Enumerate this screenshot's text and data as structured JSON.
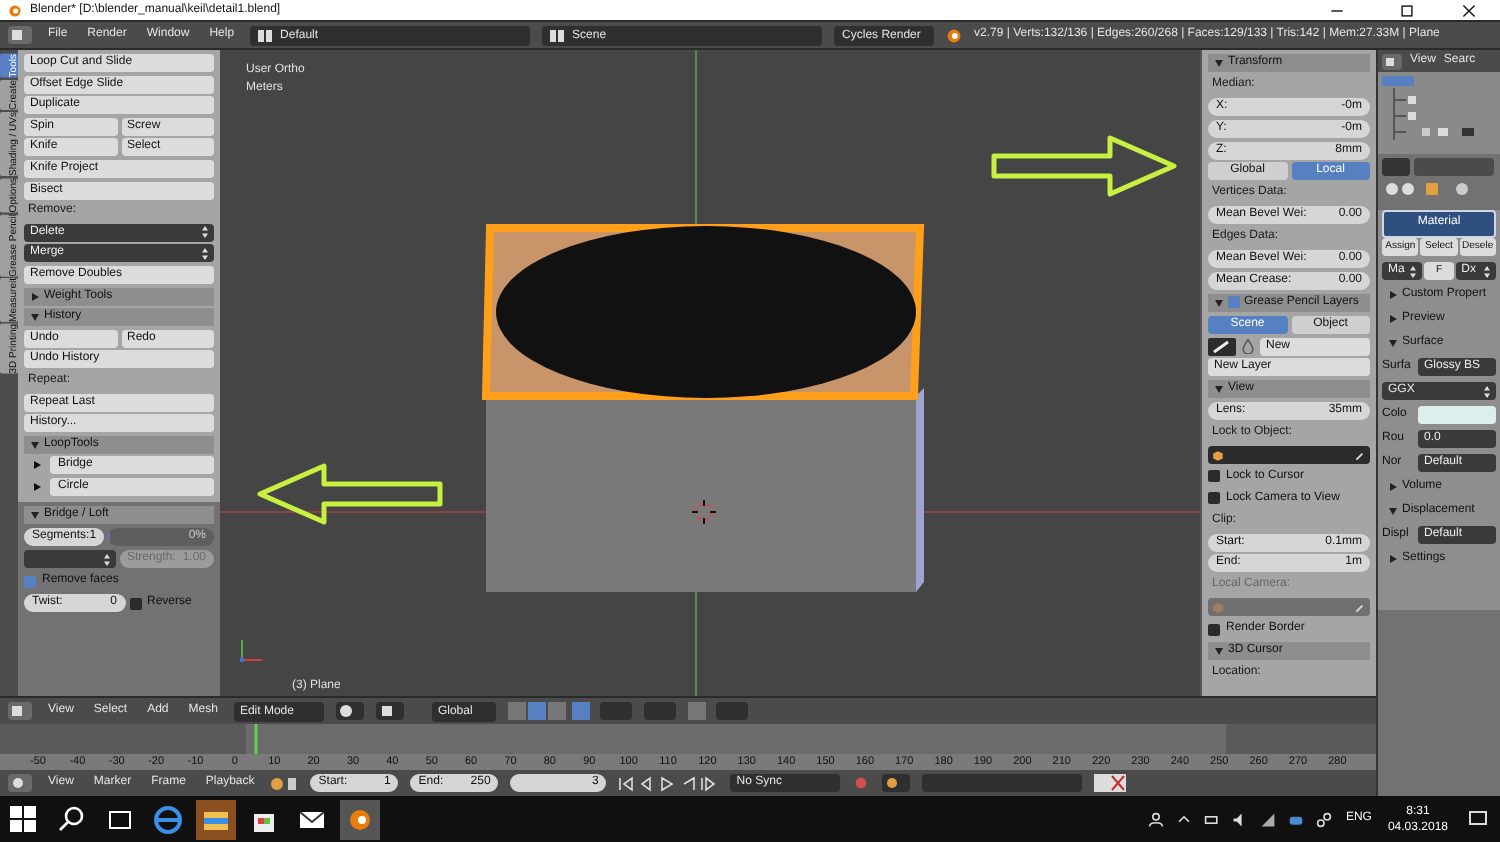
{
  "window": {
    "title": "Blender* [D:\\blender_manual\\keil\\detail1.blend]"
  },
  "info_header": {
    "menus": [
      "File",
      "Render",
      "Window",
      "Help"
    ],
    "layout": "Default",
    "scene": "Scene",
    "engine": "Cycles Render",
    "stats": "v2.79 | Verts:132/136 | Edges:260/268 | Faces:129/133 | Tris:142 | Mem:27.33M | Plane"
  },
  "tool_tabs": [
    {
      "label": "Tools",
      "selected": true
    },
    {
      "label": "Create",
      "selected": false
    },
    {
      "label": "Shading / UVs",
      "selected": false
    },
    {
      "label": "Options",
      "selected": false
    },
    {
      "label": "Grease Pencil",
      "selected": false
    },
    {
      "label": "Measureit",
      "selected": false
    },
    {
      "label": "3D Printing",
      "selected": false
    }
  ],
  "tool_panel": {
    "rows": [
      {
        "items": [
          {
            "kind": "button",
            "label": "Loop Cut and Slide"
          }
        ]
      },
      {
        "items": [
          {
            "kind": "button",
            "label": "Offset Edge Slide"
          }
        ]
      },
      {
        "items": [
          {
            "kind": "button",
            "label": "Duplicate"
          }
        ]
      },
      {
        "items": [
          {
            "kind": "button",
            "label": "Spin"
          },
          {
            "kind": "button",
            "label": "Screw"
          }
        ]
      },
      {
        "items": [
          {
            "kind": "button",
            "label": "Knife"
          },
          {
            "kind": "button",
            "label": "Select"
          }
        ]
      },
      {
        "items": [
          {
            "kind": "button",
            "label": "Knife Project"
          }
        ]
      },
      {
        "items": [
          {
            "kind": "button",
            "label": "Bisect"
          }
        ]
      },
      {
        "items": [
          {
            "kind": "label",
            "label": "Remove:",
            "disabled": false
          }
        ]
      },
      {
        "items": [
          {
            "kind": "dropdown",
            "label": "Delete"
          }
        ]
      },
      {
        "items": [
          {
            "kind": "dropdown",
            "label": "Merge"
          }
        ]
      },
      {
        "items": [
          {
            "kind": "button",
            "label": "Remove Doubles"
          }
        ]
      },
      {
        "items": [
          {
            "kind": "header",
            "label": "Weight Tools",
            "expanded": false
          }
        ]
      },
      {
        "items": [
          {
            "kind": "header",
            "label": "History",
            "expanded": true
          }
        ]
      },
      {
        "items": [
          {
            "kind": "button",
            "label": "Undo"
          },
          {
            "kind": "button",
            "label": "Redo"
          }
        ]
      },
      {
        "items": [
          {
            "kind": "button",
            "label": "Undo History"
          }
        ]
      },
      {
        "items": [
          {
            "kind": "label",
            "label": "Repeat:",
            "disabled": false
          }
        ]
      },
      {
        "items": [
          {
            "kind": "button",
            "label": "Repeat Last"
          }
        ]
      },
      {
        "items": [
          {
            "kind": "button",
            "label": "History..."
          }
        ]
      },
      {
        "items": [
          {
            "kind": "header",
            "label": "LoopTools",
            "expanded": true
          }
        ]
      },
      {
        "items": [
          {
            "kind": "tree",
            "label": "Bridge"
          }
        ]
      },
      {
        "items": [
          {
            "kind": "tree",
            "label": "Circle"
          }
        ]
      }
    ]
  },
  "redo_panel": {
    "rows": [
      {
        "items": [
          {
            "kind": "header",
            "label": "Bridge / Loft",
            "expanded": true
          }
        ]
      },
      {
        "items": [
          {
            "kind": "field",
            "label": "Segments:",
            "value": "1",
            "disabled": false
          },
          {
            "kind": "slider",
            "value": "0%",
            "level": 0
          }
        ]
      },
      {
        "items": [
          {
            "kind": "dropdown"
          },
          {
            "kind": "field",
            "label": "Strength:",
            "value": "1.00",
            "disabled": true
          }
        ]
      },
      {
        "items": [
          {
            "kind": "check",
            "label": "Remove faces",
            "checked": true
          }
        ]
      },
      {
        "items": [
          {
            "kind": "field",
            "label": "Twist:",
            "value": "0",
            "disabled": false
          },
          {
            "kind": "check",
            "label": "Reverse",
            "checked": false
          }
        ]
      }
    ]
  },
  "viewport": {
    "view_name": "User Ortho",
    "units": "Meters",
    "object_info": "(3) Plane"
  },
  "n_panel": {
    "rows": [
      {
        "items": [
          {
            "kind": "header",
            "label": "Transform",
            "expanded": true
          }
        ]
      },
      {
        "items": [
          {
            "kind": "label",
            "label": "Median:",
            "disabled": false
          }
        ]
      },
      {
        "items": [
          {
            "kind": "field",
            "label": "X:",
            "value": "-0m",
            "disabled": false
          }
        ]
      },
      {
        "items": [
          {
            "kind": "field",
            "label": "Y:",
            "value": "-0m",
            "disabled": false
          }
        ]
      },
      {
        "items": [
          {
            "kind": "field",
            "label": "Z:",
            "value": "8mm",
            "disabled": false
          }
        ]
      },
      {
        "items": [
          {
            "kind": "tab",
            "label": "Global",
            "selected": false
          },
          {
            "kind": "tab",
            "label": "Local",
            "selected": true
          }
        ]
      },
      {
        "items": [
          {
            "kind": "label",
            "label": "Vertices Data:",
            "disabled": false
          }
        ]
      },
      {
        "items": [
          {
            "kind": "field",
            "label": "Mean Bevel Wei:",
            "value": "0.00",
            "disabled": false
          }
        ]
      },
      {
        "items": [
          {
            "kind": "label",
            "label": "Edges Data:",
            "disabled": false
          }
        ]
      },
      {
        "items": [
          {
            "kind": "field",
            "label": "Mean Bevel Wei:",
            "value": "0.00",
            "disabled": false
          }
        ]
      },
      {
        "items": [
          {
            "kind": "field",
            "label": "Mean Crease:",
            "value": "0.00",
            "disabled": false
          }
        ]
      },
      {
        "items": [
          {
            "kind": "header",
            "label": "Grease Pencil Layers",
            "expanded": true,
            "checked": true
          }
        ]
      },
      {
        "items": [
          {
            "kind": "tab",
            "label": "Scene",
            "selected": true
          },
          {
            "kind": "tab",
            "label": "Object",
            "selected": false
          }
        ]
      },
      {
        "items": [
          {
            "kind": "pencil_button"
          },
          {
            "kind": "drop_icon"
          },
          {
            "kind": "button",
            "label": "New"
          }
        ]
      },
      {
        "items": [
          {
            "kind": "button",
            "label": "New Layer"
          }
        ]
      },
      {
        "items": [
          {
            "kind": "header",
            "label": "View",
            "expanded": true
          }
        ]
      },
      {
        "items": [
          {
            "kind": "field",
            "label": "Lens:",
            "value": "35mm",
            "disabled": false
          }
        ]
      },
      {
        "items": [
          {
            "kind": "label",
            "label": "Lock to Object:",
            "disabled": false
          }
        ]
      },
      {
        "items": [
          {
            "kind": "object_field",
            "disabled": false
          }
        ]
      },
      {
        "items": [
          {
            "kind": "check",
            "label": "Lock to Cursor",
            "checked": false
          }
        ]
      },
      {
        "items": [
          {
            "kind": "check",
            "label": "Lock Camera to View",
            "checked": false
          }
        ]
      },
      {
        "items": [
          {
            "kind": "label",
            "label": "Clip:",
            "disabled": false
          }
        ]
      },
      {
        "items": [
          {
            "kind": "field",
            "label": "Start:",
            "value": "0.1mm",
            "disabled": false
          }
        ]
      },
      {
        "items": [
          {
            "kind": "field",
            "label": "End:",
            "value": "1m",
            "disabled": false
          }
        ]
      },
      {
        "items": [
          {
            "kind": "label",
            "label": "Local Camera:",
            "disabled": true
          }
        ]
      },
      {
        "items": [
          {
            "kind": "object_field",
            "disabled": true
          }
        ]
      },
      {
        "items": [
          {
            "kind": "check",
            "label": "Render Border",
            "checked": false
          }
        ]
      },
      {
        "items": [
          {
            "kind": "header",
            "label": "3D Cursor",
            "expanded": true
          }
        ]
      },
      {
        "items": [
          {
            "kind": "label",
            "label": "Location:",
            "disabled": false
          }
        ]
      }
    ]
  },
  "outliner": {
    "menus": [
      "View",
      "Searc"
    ]
  },
  "properties": {
    "rows": [
      {
        "items": [
          {
            "kind": "material_slot",
            "label": "Material"
          }
        ]
      },
      {
        "items": [
          {
            "kind": "button",
            "label": "Assign"
          },
          {
            "kind": "button",
            "label": "Select"
          },
          {
            "kind": "button",
            "label": "Desele"
          }
        ]
      },
      {
        "items": [
          {
            "kind": "dropdown",
            "label": "Ma"
          },
          {
            "kind": "button",
            "label": "F"
          },
          {
            "kind": "dropdown",
            "label": "Dx"
          }
        ]
      },
      {
        "items": [
          {
            "kind": "header",
            "label": "Custom Propert",
            "expanded": false
          }
        ]
      },
      {
        "items": [
          {
            "kind": "header",
            "label": "Preview",
            "expanded": false
          }
        ]
      },
      {
        "items": [
          {
            "kind": "header",
            "label": "Surface",
            "expanded": true
          }
        ]
      },
      {
        "items": [
          {
            "kind": "prop",
            "label": "Surfa",
            "value": "Glossy BS"
          }
        ]
      },
      {
        "items": [
          {
            "kind": "dropdown",
            "label": "GGX"
          }
        ]
      },
      {
        "items": [
          {
            "kind": "color_prop",
            "label": "Colo"
          }
        ]
      },
      {
        "items": [
          {
            "kind": "prop",
            "label": "Rou",
            "value": "0.0"
          }
        ]
      },
      {
        "items": [
          {
            "kind": "prop",
            "label": "Nor",
            "value": "Default"
          }
        ]
      },
      {
        "items": [
          {
            "kind": "header",
            "label": "Volume",
            "expanded": false
          }
        ]
      },
      {
        "items": [
          {
            "kind": "header",
            "label": "Displacement",
            "expanded": true
          }
        ]
      },
      {
        "items": [
          {
            "kind": "prop",
            "label": "Displ",
            "value": "Default"
          }
        ]
      },
      {
        "items": [
          {
            "kind": "header",
            "label": "Settings",
            "expanded": false
          }
        ]
      }
    ]
  },
  "view3d_header": {
    "menus": [
      "View",
      "Select",
      "Add",
      "Mesh"
    ],
    "mode": "Edit Mode",
    "orientation": "Global"
  },
  "timeline": {
    "frame_labels": [
      "-50",
      "-40",
      "-30",
      "-20",
      "-10",
      "0",
      "10",
      "20",
      "30",
      "40",
      "50",
      "60",
      "70",
      "80",
      "90",
      "100",
      "110",
      "120",
      "130",
      "140",
      "150",
      "160",
      "170",
      "180",
      "190",
      "200",
      "210",
      "220",
      "230",
      "240",
      "250",
      "260",
      "270",
      "280"
    ]
  },
  "timeline_header": {
    "menus": [
      "View",
      "Marker",
      "Frame",
      "Playback"
    ],
    "start": {
      "label": "Start:",
      "value": "1"
    },
    "end": {
      "label": "End:",
      "value": "250"
    },
    "current_frame": "3",
    "sync": "No Sync"
  },
  "taskbar": {
    "language": "ENG",
    "time": "8:31",
    "date": "04.03.2018"
  }
}
